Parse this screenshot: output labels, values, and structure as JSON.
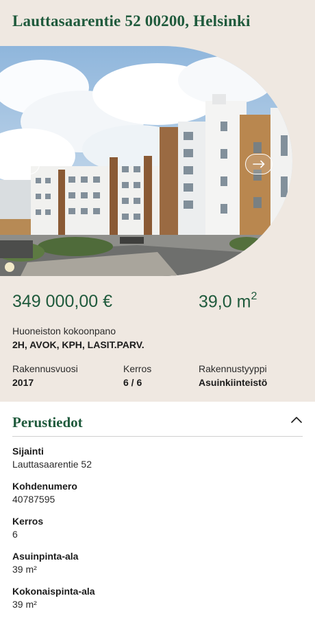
{
  "header": {
    "address": "Lauttasaarentie 52 00200, Helsinki"
  },
  "gallery": {
    "prev_icon": "arrow-left-icon",
    "next_icon": "arrow-right-icon"
  },
  "summary": {
    "price": "349 000,00 €",
    "area": "39,0 m",
    "area_unit_sup": "2",
    "layout_label": "Huoneiston kokoonpano",
    "layout_value": "2H, AVOK, KPH, LASIT.PARV.",
    "year_label": "Rakennusvuosi",
    "year_value": "2017",
    "floor_label": "Kerros",
    "floor_value": "6 / 6",
    "type_label": "Rakennustyyppi",
    "type_value": "Asuinkiinteistö"
  },
  "basic_info": {
    "title": "Perustiedot",
    "toggle_icon": "chevron-up-icon",
    "fields": [
      {
        "label": "Sijainti",
        "value": "Lauttasaarentie 52"
      },
      {
        "label": "Kohdenumero",
        "value": "40787595"
      },
      {
        "label": "Kerros",
        "value": "6"
      },
      {
        "label": "Asuinpinta-ala",
        "value": "39 m²"
      },
      {
        "label": "Kokonaispinta-ala",
        "value": "39 m²"
      }
    ]
  },
  "colors": {
    "accent": "#1f5a3c",
    "top_background": "#efe8e1"
  }
}
